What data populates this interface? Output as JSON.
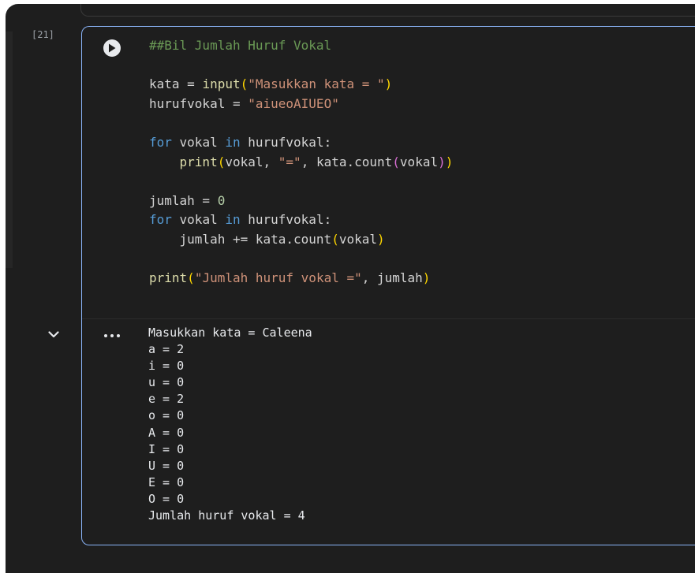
{
  "cell": {
    "execution_count": "[21]",
    "code_lines": [
      [
        {
          "t": "##Bil Jumlah Huruf Vokal",
          "c": "comment"
        }
      ],
      [],
      [
        {
          "t": "kata = ",
          "c": "plain"
        },
        {
          "t": "input",
          "c": "builtin"
        },
        {
          "t": "(",
          "c": "paren"
        },
        {
          "t": "\"Masukkan kata = \"",
          "c": "string"
        },
        {
          "t": ")",
          "c": "paren"
        }
      ],
      [
        {
          "t": "hurufvokal = ",
          "c": "plain"
        },
        {
          "t": "\"aiueoAIUEO\"",
          "c": "string"
        }
      ],
      [],
      [
        {
          "t": "for",
          "c": "keyword"
        },
        {
          "t": " vokal ",
          "c": "plain"
        },
        {
          "t": "in",
          "c": "keyword"
        },
        {
          "t": " hurufvokal:",
          "c": "plain"
        }
      ],
      [
        {
          "t": "    ",
          "c": "plain"
        },
        {
          "t": "print",
          "c": "builtin"
        },
        {
          "t": "(",
          "c": "paren"
        },
        {
          "t": "vokal, ",
          "c": "plain"
        },
        {
          "t": "\"=\"",
          "c": "string"
        },
        {
          "t": ", kata.count",
          "c": "plain"
        },
        {
          "t": "(",
          "c": "paren2"
        },
        {
          "t": "vokal",
          "c": "plain"
        },
        {
          "t": ")",
          "c": "paren2"
        },
        {
          "t": ")",
          "c": "paren"
        }
      ],
      [],
      [
        {
          "t": "jumlah = ",
          "c": "plain"
        },
        {
          "t": "0",
          "c": "number"
        }
      ],
      [
        {
          "t": "for",
          "c": "keyword"
        },
        {
          "t": " vokal ",
          "c": "plain"
        },
        {
          "t": "in",
          "c": "keyword"
        },
        {
          "t": " hurufvokal:",
          "c": "plain"
        }
      ],
      [
        {
          "t": "    jumlah += kata.count",
          "c": "plain"
        },
        {
          "t": "(",
          "c": "paren"
        },
        {
          "t": "vokal",
          "c": "plain"
        },
        {
          "t": ")",
          "c": "paren"
        }
      ],
      [],
      [
        {
          "t": "print",
          "c": "builtin"
        },
        {
          "t": "(",
          "c": "paren"
        },
        {
          "t": "\"Jumlah huruf vokal =\"",
          "c": "string"
        },
        {
          "t": ", jumlah",
          "c": "plain"
        },
        {
          "t": ")",
          "c": "paren"
        }
      ]
    ],
    "output_lines": [
      "Masukkan kata = Caleena",
      "a = 2",
      "i = 0",
      "u = 0",
      "e = 2",
      "o = 0",
      "A = 0",
      "I = 0",
      "U = 0",
      "E = 0",
      "O = 0",
      "Jumlah huruf vokal = 4"
    ]
  },
  "icons": {
    "run": "play-circle-icon",
    "collapse": "chevron-down-icon",
    "menu": "more-horizontal-icon"
  },
  "colors": {
    "background": "#1e1e1e",
    "cell_border": "#8ab4f8",
    "comment": "#6a9955",
    "keyword": "#569cd6",
    "builtin": "#dcdcaa",
    "string": "#ce9178",
    "paren": "#ffd700",
    "paren_nested": "#da70d6",
    "number": "#b5cea8"
  }
}
